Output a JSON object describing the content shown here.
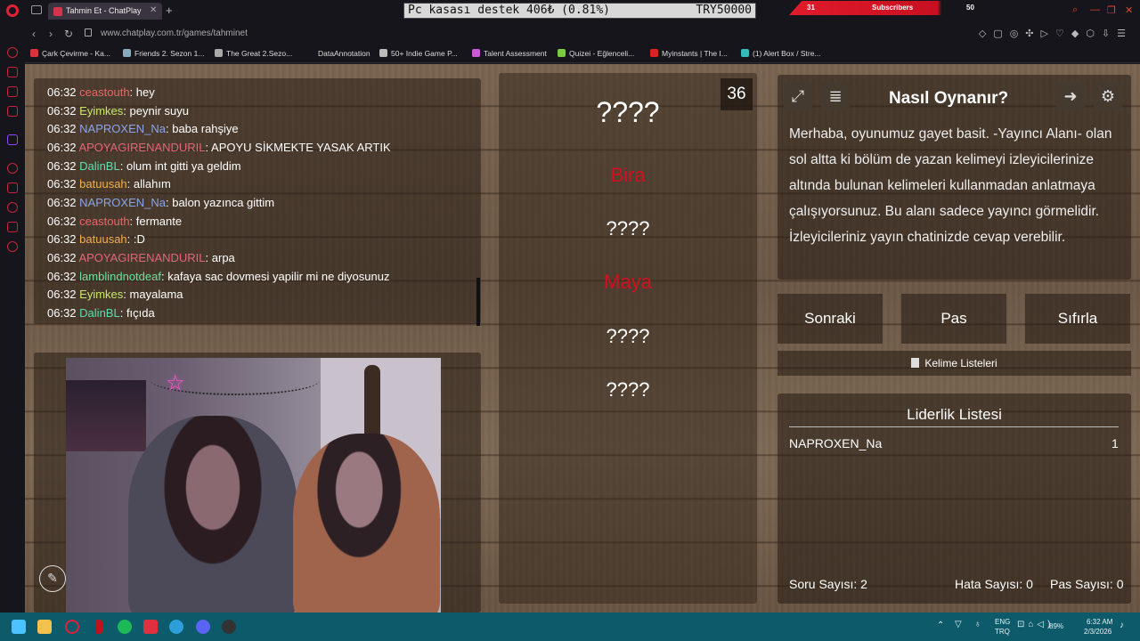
{
  "browser": {
    "tab_title": "Tahmin Et - ChatPlay",
    "tab_favicon": "CP",
    "url": "www.chatplay.com.tr/games/tahminet"
  },
  "overlay": {
    "ticker_text": "Pc kasası destek  406₺ (0.81%)",
    "ticker_goal": "TRY50000",
    "subs_left": "31",
    "subs_label": "Subscribers",
    "subs_right": "50"
  },
  "bookmarks": [
    {
      "label": "Çark Çevirme - Ka...",
      "color": "#d8343a"
    },
    {
      "label": "Friends 2. Sezon 1...",
      "color": "#8ab"
    },
    {
      "label": "The Great 2.Sezo...",
      "color": "#aaa"
    },
    {
      "label": "DataAnnotation",
      "color": "#16151c"
    },
    {
      "label": "50+ Indie Game P...",
      "color": "#bbb"
    },
    {
      "label": "Talent Assessment",
      "color": "#c65bd8"
    },
    {
      "label": "Quizei - Eğlenceli...",
      "color": "#7c4"
    },
    {
      "label": "Myinstants | The I...",
      "color": "#d22"
    },
    {
      "label": "(1) Alert Box / Stre...",
      "color": "#3bb"
    }
  ],
  "chat": {
    "messages": [
      {
        "time": "06:32",
        "user": "ceastouth",
        "text": "hey",
        "color": "#e26a6a"
      },
      {
        "time": "06:32",
        "user": "Eyimkes",
        "text": "peynir suyu",
        "color": "#c6e86a"
      },
      {
        "time": "06:32",
        "user": "NAPROXEN_Na",
        "text": "baba rahşiye",
        "color": "#8aa4e8"
      },
      {
        "time": "06:32",
        "user": "APOYAGIRENANDURIL",
        "text": "APOYU SİKMEKTE YASAK ARTIK",
        "color": "#e2667a"
      },
      {
        "time": "06:32",
        "user": "DalinBL",
        "text": "olum int gitti ya geldim",
        "color": "#58e0b0"
      },
      {
        "time": "06:32",
        "user": "batuusah",
        "text": "allahım",
        "color": "#f0b04a"
      },
      {
        "time": "06:32",
        "user": "NAPROXEN_Na",
        "text": "balon yazınca gittim",
        "color": "#8aa4e8"
      },
      {
        "time": "06:32",
        "user": "ceastouth",
        "text": "fermante",
        "color": "#e26a6a"
      },
      {
        "time": "06:32",
        "user": "batuusah",
        "text": ":D",
        "color": "#f0b04a"
      },
      {
        "time": "06:32",
        "user": "APOYAGIRENANDURIL",
        "text": "arpa",
        "color": "#e2667a"
      },
      {
        "time": "06:32",
        "user": "lamblindnotdeaf",
        "text": "kafaya sac dovmesi yapilir mi ne diyosunuz",
        "color": "#6ae0a0"
      },
      {
        "time": "06:32",
        "user": "Eyimkes",
        "text": "mayalama",
        "color": "#c6e86a"
      },
      {
        "time": "06:32",
        "user": "DalinBL",
        "text": "fıçıda",
        "color": "#58e0b0"
      }
    ]
  },
  "game": {
    "timer": "36",
    "words": [
      {
        "text": "????",
        "hidden": true
      },
      {
        "text": "Bira",
        "hidden": false
      },
      {
        "text": "????",
        "hidden": true
      },
      {
        "text": "Maya",
        "hidden": false
      },
      {
        "text": "????",
        "hidden": true
      },
      {
        "text": "????",
        "hidden": true
      }
    ],
    "howto_title": "Nasıl Oynanır?",
    "howto_text": "Merhaba, oyunumuz gayet basit. -Yayıncı Alanı- olan sol altta ki bölüm de yazan kelimeyi izleyicilerinize altında bulunan kelimeleri kullanmadan anlatmaya çalışıyorsunuz. Bu alanı sadece yayıncı görmelidir. İzleyicileriniz yayın chatinizde cevap verebilir.",
    "buttons": {
      "next": "Sonraki",
      "pass": "Pas",
      "reset": "Sıfırla"
    },
    "word_lists_label": "Kelime Listeleri",
    "leaderboard": {
      "title": "Liderlik Listesi",
      "entries": [
        {
          "name": "NAPROXEN_Na",
          "score": "1"
        }
      ]
    },
    "stats": {
      "questions": "Soru Sayısı: 2",
      "errors": "Hata Sayısı: 0",
      "passes": "Pas Sayısı: 0"
    }
  },
  "taskbar": {
    "lang_top": "ENG",
    "lang_bottom": "TRQ",
    "battery": "89%",
    "time": "6:32 AM",
    "date": "2/3/2026"
  }
}
